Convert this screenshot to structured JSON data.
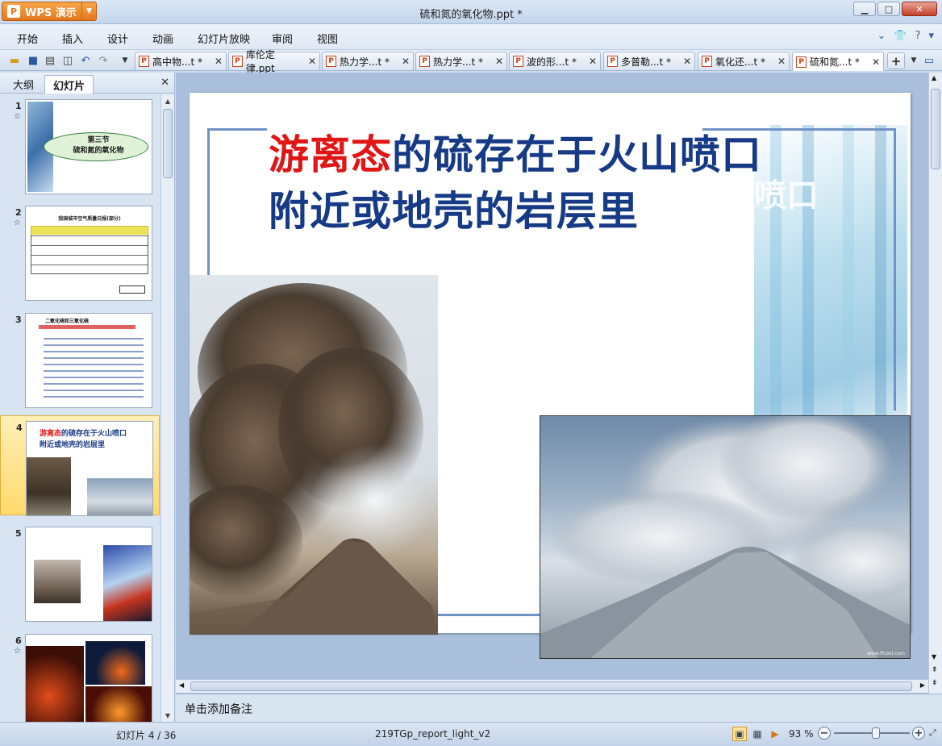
{
  "app": {
    "button_label": "WPS 演示",
    "logo_letter": "P",
    "window_title": "硫和氮的氧化物.ppt *"
  },
  "menu": {
    "items": [
      "开始",
      "插入",
      "设计",
      "动画",
      "幻灯片放映",
      "审阅",
      "视图"
    ]
  },
  "tabs": [
    {
      "label": "高中物...t *",
      "active": false
    },
    {
      "label": "库伦定律.ppt",
      "active": false
    },
    {
      "label": "热力学...t *",
      "active": false
    },
    {
      "label": "热力学...t *",
      "active": false
    },
    {
      "label": "波的形...t *",
      "active": false
    },
    {
      "label": "多普勒...t *",
      "active": false
    },
    {
      "label": "氧化还...t *",
      "active": false
    },
    {
      "label": "硫和氮...t *",
      "active": true
    }
  ],
  "left_pane": {
    "tab_outline": "大纲",
    "tab_slides": "幻灯片",
    "thumbnails": [
      {
        "num": "1",
        "star": "☆",
        "caption": "第三节\n硫和氮的氧化物"
      },
      {
        "num": "2",
        "star": "☆",
        "caption": "我国城市空气质量日报(部分)"
      },
      {
        "num": "3",
        "star": "",
        "caption": "二氧化硫和三氧化硫"
      },
      {
        "num": "4",
        "star": "",
        "caption": "游离态的硫存在于火山喷口附近或地壳的岩层里"
      },
      {
        "num": "5",
        "star": "",
        "caption": ""
      },
      {
        "num": "6",
        "star": "☆",
        "caption": ""
      }
    ],
    "active_index": 3
  },
  "slide": {
    "title_red": "游离态",
    "title_rest_line1": "的硫存在于火山喷口",
    "title_line2": "附近或地壳的岩层里",
    "ghost_text": "喷口",
    "image_left": "volcano-eruption-photo",
    "image_right": "volcano-ash-cloud-photo",
    "watermark": "www.lfcool.com"
  },
  "notes": {
    "placeholder": "单击添加备注"
  },
  "status": {
    "slide_indicator": "幻灯片 4 / 36",
    "theme_name": "219TGp_report_light_v2",
    "zoom": "93 %",
    "zoom_fraction": 0.55
  },
  "colors": {
    "title_blue": "#173a86",
    "title_red": "#e11515",
    "accent_orange": "#e3771d"
  }
}
